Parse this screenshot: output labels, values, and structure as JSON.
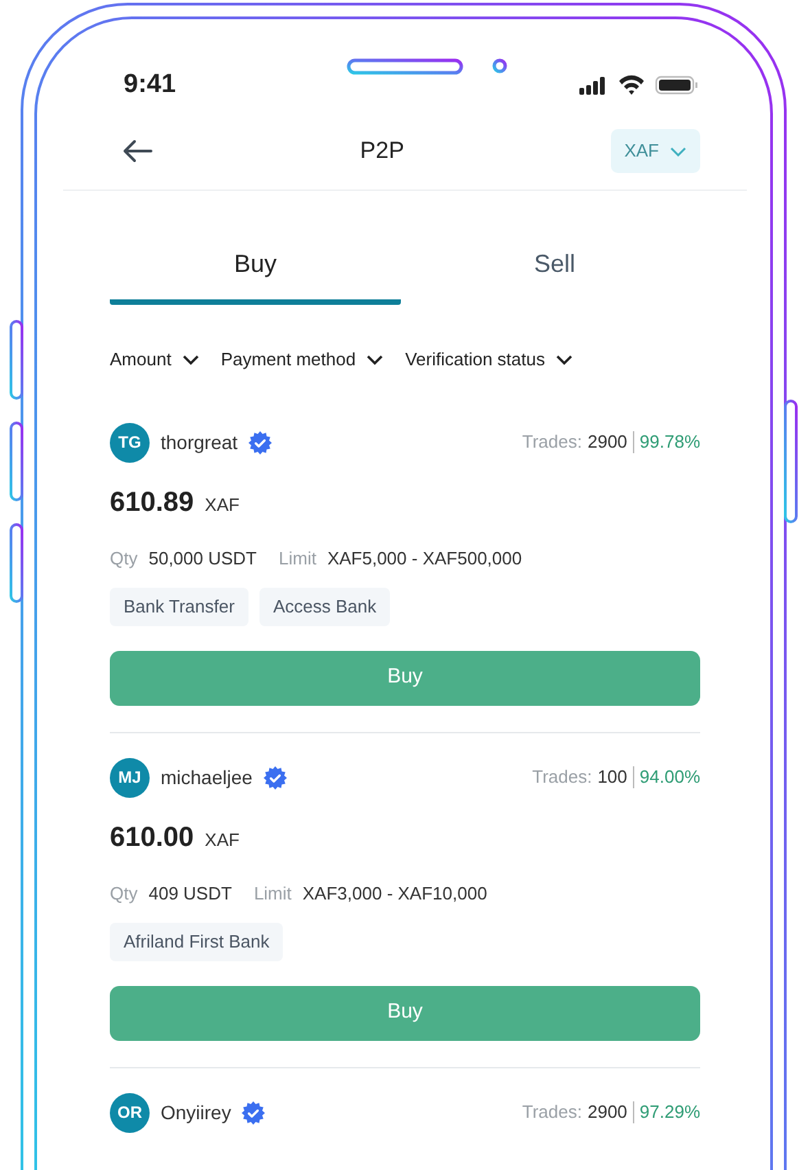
{
  "status_bar": {
    "time": "9:41"
  },
  "header": {
    "title": "P2P",
    "currency": "XAF"
  },
  "tabs": [
    {
      "label": "Buy",
      "selected": true
    },
    {
      "label": "Sell",
      "selected": false
    }
  ],
  "filters": [
    "Amount",
    "Payment method",
    "Verification status"
  ],
  "offers": [
    {
      "initials": "TG",
      "name": "thorgreat",
      "verified": true,
      "trades_label": "Trades:",
      "trades": "2900",
      "rate": "99.78%",
      "price": "610.89",
      "price_currency": "XAF",
      "qty_label": "Qty",
      "qty": "50,000 USDT",
      "limit_label": "Limit",
      "limit": "XAF5,000 - XAF500,000",
      "methods": [
        "Bank Transfer",
        "Access Bank"
      ],
      "button": "Buy"
    },
    {
      "initials": "MJ",
      "name": "michaeljee",
      "verified": true,
      "trades_label": "Trades:",
      "trades": "100",
      "rate": "94.00%",
      "price": "610.00",
      "price_currency": "XAF",
      "qty_label": "Qty",
      "qty": "409 USDT",
      "limit_label": "Limit",
      "limit": "XAF3,000 - XAF10,000",
      "methods": [
        "Afriland First Bank"
      ],
      "button": "Buy"
    },
    {
      "initials": "OR",
      "name": "Onyiirey",
      "verified": true,
      "trades_label": "Trades:",
      "trades": "2900",
      "rate": "97.29%"
    }
  ]
}
